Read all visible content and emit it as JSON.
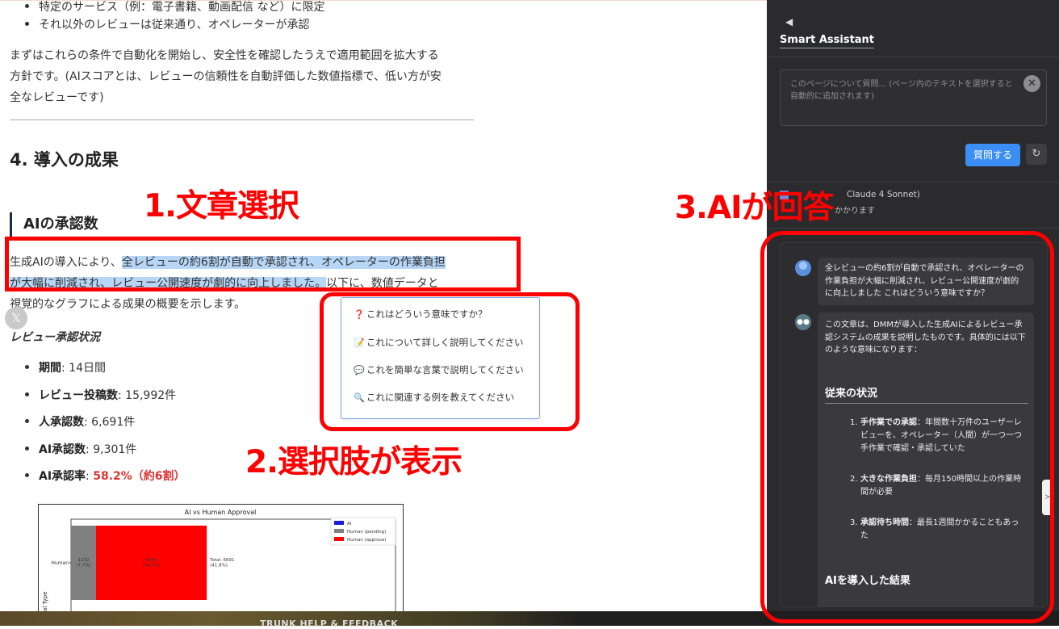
{
  "article": {
    "top_bullets": [
      "特定のサービス（例：電子書籍、動画配信 など）に限定",
      "それ以外のレビューは従来通り、オペレーターが承認"
    ],
    "policy_para_line1": "まずはこれらの条件で自動化を開始し、安全性を確認したうえで適用範囲を拡大する",
    "policy_para_line2": "方針です。(AIスコアとは、レビューの信頼性を自動評価した数値指標で、低い方が安",
    "policy_para_line3": "全なレビューです)",
    "section_heading": "4. 導入の成果",
    "sub_heading": "AIの承認数",
    "intro_pre": "生成AIの導入により、",
    "intro_highlight_1": "全レビューの約6割が自動で承認され、オペレーターの作業負担",
    "intro_highlight_2": "が大幅に削減され、レビュー公開速度が劇的に向上しました。",
    "intro_post_1": "以下に、数値データと",
    "intro_line3": "視覚的なグラフによる成果の概要を示します。",
    "share_icon": "x-icon",
    "review_status_heading": "レビュー承認状況",
    "stats": [
      {
        "label": "期間",
        "value": ": 14日間"
      },
      {
        "label": "レビュー投稿数",
        "value": ": 15,992件"
      },
      {
        "label": "人承認数",
        "value": ": 6,691件"
      },
      {
        "label": "AI承認数",
        "value": ": 9,301件"
      },
      {
        "label": "AI承認率",
        "value": ": ",
        "highlight": "58.2%（約6割）"
      }
    ]
  },
  "chart_data": {
    "type": "bar",
    "orientation": "horizontal-stacked",
    "title": "AI vs Human Approval",
    "ylabel": "al Type",
    "categories": [
      "Human"
    ],
    "series": [
      {
        "name": "AI",
        "values": [
          0
        ],
        "color": "#1a1adb"
      },
      {
        "name": "Human (pending)",
        "values": [
          1232
        ],
        "color": "#808080",
        "label": "1232\n(7.7%)"
      },
      {
        "name": "Human (approve)",
        "values": [
          5459
        ],
        "color": "#ff0000",
        "label": "5459\n(34.1%)"
      }
    ],
    "total_label": "Total: 6691\n(41.8%)",
    "legend": "top-right",
    "xlim": [
      0,
      16000
    ]
  },
  "context_menu": {
    "items": [
      {
        "icon": "question-mark-icon",
        "glyph": "❓",
        "label": "これはどういう意味ですか？"
      },
      {
        "icon": "memo-icon",
        "glyph": "📝",
        "label": "これについて詳しく説明してください"
      },
      {
        "icon": "speech-bubble-icon",
        "glyph": "💬",
        "label": "これを簡単な言葉で説明してください"
      },
      {
        "icon": "magnifier-icon",
        "glyph": "🔍",
        "label": "これに関連する例を教えてください"
      }
    ]
  },
  "panel": {
    "back_icon": "◀",
    "title": "Smart Assistant",
    "input_placeholder": "このページについて質問... (ページ内のテキストを選択すると自動的に追加されます)",
    "clear_glyph": "✕",
    "ask_label": "質問する",
    "refresh_glyph": "↻",
    "model_line": "Claude 4 Sonnet)",
    "model_sub": "かかります",
    "user_message": "全レビューの約6割が自動で承認され、オペレーターの作業負担が大幅に削減され、レビュー公開速度が劇的に向上しました これはどういう意味ですか？",
    "bot_intro": "この文章は、DMMが導入した生成AIによるレビュー承認システムの成果を説明したものです。具体的には以下のような意味になります：",
    "bot_section1": "従来の状況",
    "bot_items": [
      {
        "n": "1.",
        "bold": "手作業での承認",
        "text": "：年間数十万件のユーザーレビューを、オペレーター（人間）が一つ一つ手作業で確認・承認していた"
      },
      {
        "n": "2.",
        "bold": "大きな作業負担",
        "text": "：毎月150時間以上の作業時間が必要"
      },
      {
        "n": "3.",
        "bold": "承認待ち時間",
        "text": "：最長1週間かかることもあった"
      }
    ],
    "bot_section2": "AIを導入した結果",
    "scroll_glyph": "≻"
  },
  "footer": {
    "bottom_text": "TRUNK HELP & FEEDBACK"
  },
  "annotations": {
    "label1": "1.文章選択",
    "label2": "2.選択肢が表示",
    "label3": "3.AIが回答",
    "color": "#ff0000"
  }
}
